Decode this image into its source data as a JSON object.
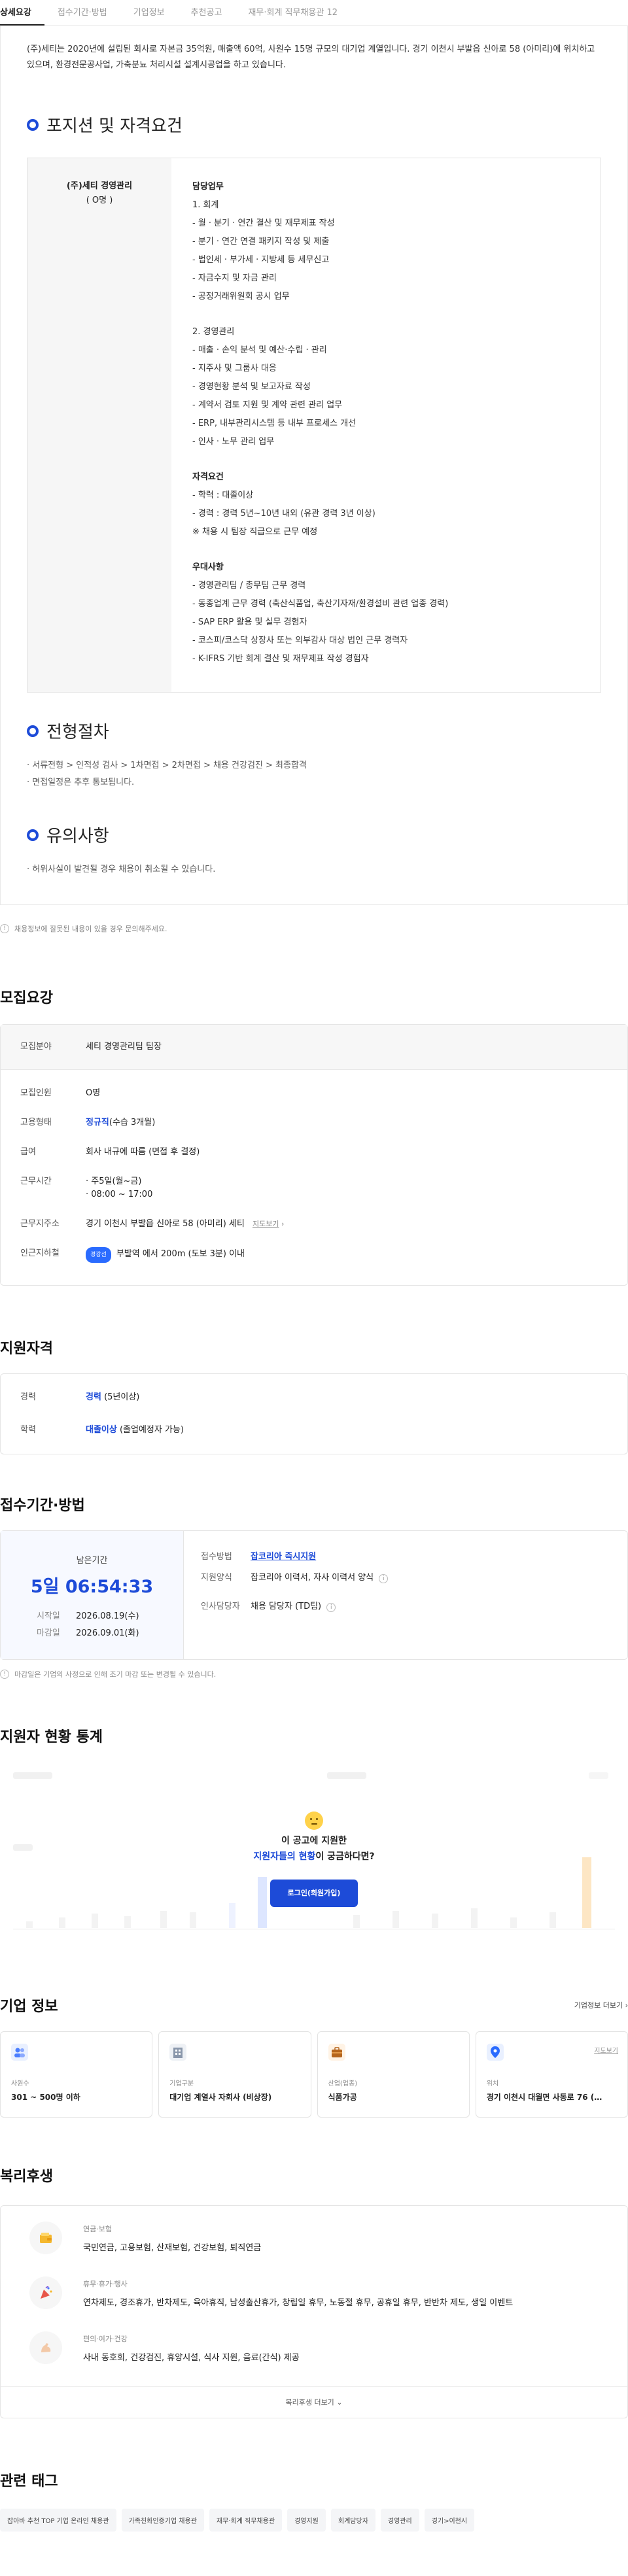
{
  "tabs": [
    "상세요강",
    "접수기간·방법",
    "기업정보",
    "추천공고",
    "재무·회계 직무채용관 12"
  ],
  "intro": "(주)세티는 2020년에 설립된 회사로 자본금 35억원, 매출액 60억, 사원수 15명 규모의 대기업 계열입니다. 경기 이천시 부발읍 신아로 58 (아미리)에 위치하고 있으며, 환경전문공사업, 가축분뇨 처리시설 설계시공업을 하고 있습니다.",
  "position": {
    "heading": "포지션 및 자격요건",
    "company": "(주)세티 경영관리",
    "headcount": "( O명 )",
    "duties_title": "담당업무",
    "group1_title": "1. 회계",
    "group1_items": [
      "- 월 · 분기 · 연간 결산 및 재무제표 작성",
      "- 분기 · 연간 연결 패키지 작성 및 제출",
      "- 법인세 · 부가세 · 지방세 등 세무신고",
      "- 자금수지 및 자금 관리",
      "- 공정거래위원회 공시 업무"
    ],
    "group2_title": "2. 경영관리",
    "group2_items": [
      "- 매출 · 손익 분석 및 예산·수립 · 관리",
      "- 지주사 및 그룹사 대응",
      "- 경영현황 분석 및 보고자료 작성",
      "- 계약서 검토 지원 및 계약 관련 관리 업무",
      "- ERP, 내부관리시스템 등 내부 프로세스 개선",
      "- 인사 · 노무 관리 업무"
    ],
    "qual_title": "자격요건",
    "qual_items": [
      "- 학력 : 대졸이상",
      "- 경력 : 경력 5년~10년 내외 (유관 경력 3년 이상)",
      "※ 채용 시 팀장 직급으로 근무 예정"
    ],
    "pref_title": "우대사항",
    "pref_items": [
      "- 경영관리팀 / 총무팀 근무 경력",
      "- 동종업계 근무 경력 (축산식품업, 축산기자재/환경설비 관련 업종 경력)",
      "- SAP ERP 활용 및 실무 경험자",
      "- 코스피/코스닥 상장사 또는 외부감사 대상 법인 근무 경력자",
      "- K-IFRS 기반 회계 결산 및 재무제표 작성 경험자"
    ]
  },
  "process": {
    "heading": "전형절차",
    "steps": "· 서류전형 > 인적성 검사 > 1차면접 > 2차면접 > 채용 건강검진 > 최종합격",
    "note": "· 면접일정은 추후 통보됩니다."
  },
  "notices": {
    "heading": "유의사항",
    "text": "· 허위사실이 발견될 경우 채용이 취소될 수 있습니다."
  },
  "detail_disclaimer": "채용정보에 잘못된 내용이 있을 경우 문의해주세요.",
  "recruit": {
    "title": "모집요강",
    "field_label": "모집분야",
    "field_value": "세티 경영관리팀 팀장",
    "rows": [
      {
        "k": "모집인원",
        "v": "O명"
      },
      {
        "k": "고용형태",
        "v": "정규직",
        "sub": "(수습 3개월)"
      },
      {
        "k": "급여",
        "v": "회사 내규에 따름 (면접 후 결정)"
      },
      {
        "k": "근무시간",
        "v": "· 주5일(월~금)",
        "v2": "· 08:00 ~ 17:00"
      },
      {
        "k": "근무지주소",
        "v": "경기 이천시 부발읍 신아로 58 (아미리) 세티",
        "link": "지도보기"
      },
      {
        "k": "인근지하철",
        "badge": "경강선",
        "v": "부발역 에서 200m (도보 3분) 이내"
      }
    ]
  },
  "qualify": {
    "title": "지원자격",
    "rows": [
      {
        "k": "경력",
        "v": "경력",
        "sub": "(5년이상)"
      },
      {
        "k": "학력",
        "v": "대졸이상",
        "sub": "(졸업예정자 가능)"
      }
    ]
  },
  "apply": {
    "title": "접수기간·방법",
    "remain_label": "남은기간",
    "remain_value": "5일 06:54:33",
    "start_k": "시작일",
    "start_v": "2026.08.19(수)",
    "end_k": "마감일",
    "end_v": "2026.09.01(화)",
    "method_k": "접수방법",
    "method_v": "잡코리아 즉시지원",
    "form_k": "지원양식",
    "form_v": "잡코리아 이력서, 자사 이력서 양식",
    "hr_k": "인사담당자",
    "hr_v": "채용 담당자 (TD팀)",
    "disclaimer": "마감일은 기업의 사정으로 인해 조기 마감 또는 변경될 수 있습니다."
  },
  "stats": {
    "title": "지원자 현황 통계",
    "overlay1": "이 공고에 지원한",
    "overlay2_blue": "지원자들의 현황",
    "overlay2_rest": "이 궁금하다면?",
    "login_btn": "로그인(회원가입)"
  },
  "company": {
    "title": "기업 정보",
    "more": "기업정보 더보기",
    "cards": [
      {
        "k": "사원수",
        "v": "301 ~ 500명 이하"
      },
      {
        "k": "기업구분",
        "v": "대기업 계열사 자회사 (비상장)"
      },
      {
        "k": "산업(업종)",
        "v": "식품가공"
      },
      {
        "k": "위치",
        "v": "경기 이천시 대월면 사동로 76 (…",
        "link": "지도보기"
      }
    ]
  },
  "benefit": {
    "title": "복리후생",
    "rows": [
      {
        "k": "연금·보험",
        "v": "국민연금, 고용보험, 산재보험, 건강보험, 퇴직연금"
      },
      {
        "k": "휴무·휴가·행사",
        "v": "연차제도, 경조휴가, 반차제도, 육아휴직, 남성출산휴가, 창립일 휴무, 노동절 휴무, 공휴일 휴무, 반반차 제도, 생일 이벤트"
      },
      {
        "k": "편의·여가·건강",
        "v": "사내 동호회, 건강검진, 휴양시설, 식사 지원, 음료(간식) 제공"
      }
    ],
    "more": "복리후생 더보기"
  },
  "tags": {
    "title": "관련 태그",
    "items": [
      "잡아바 추천 TOP 기업 온라인 채용관",
      "가족친화인증기업 채용관",
      "재무·회계 직무채용관",
      "경영지원",
      "회계담당자",
      "경영관리",
      "경기>이천시"
    ]
  },
  "colors": {
    "accent": "#1d4bd8",
    "button": "#1d4bd8"
  }
}
